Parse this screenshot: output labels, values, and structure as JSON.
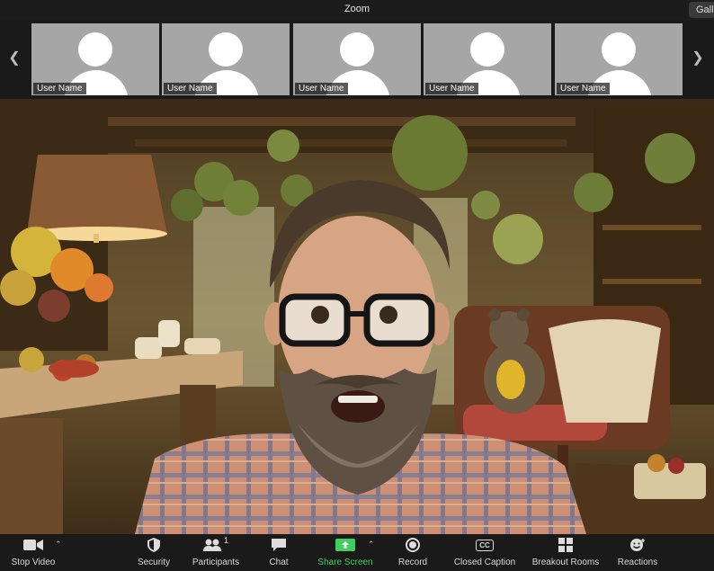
{
  "window": {
    "title": "Zoom",
    "view_button": "Gallery"
  },
  "strip": {
    "tiles": [
      {
        "name": "User Name"
      },
      {
        "name": "User Name"
      },
      {
        "name": "User Name"
      },
      {
        "name": "User Name"
      },
      {
        "name": "User Name"
      }
    ]
  },
  "toolbar": {
    "stop_video": "Stop Video",
    "security": "Security",
    "participants": "Participants",
    "participants_count": "1",
    "chat": "Chat",
    "share_screen": "Share Screen",
    "record": "Record",
    "closed_caption": "Closed Caption",
    "cc_icon_text": "CC",
    "breakout_rooms": "Breakout Rooms",
    "reactions": "Reactions",
    "accent_share": "#3fcf5f"
  }
}
